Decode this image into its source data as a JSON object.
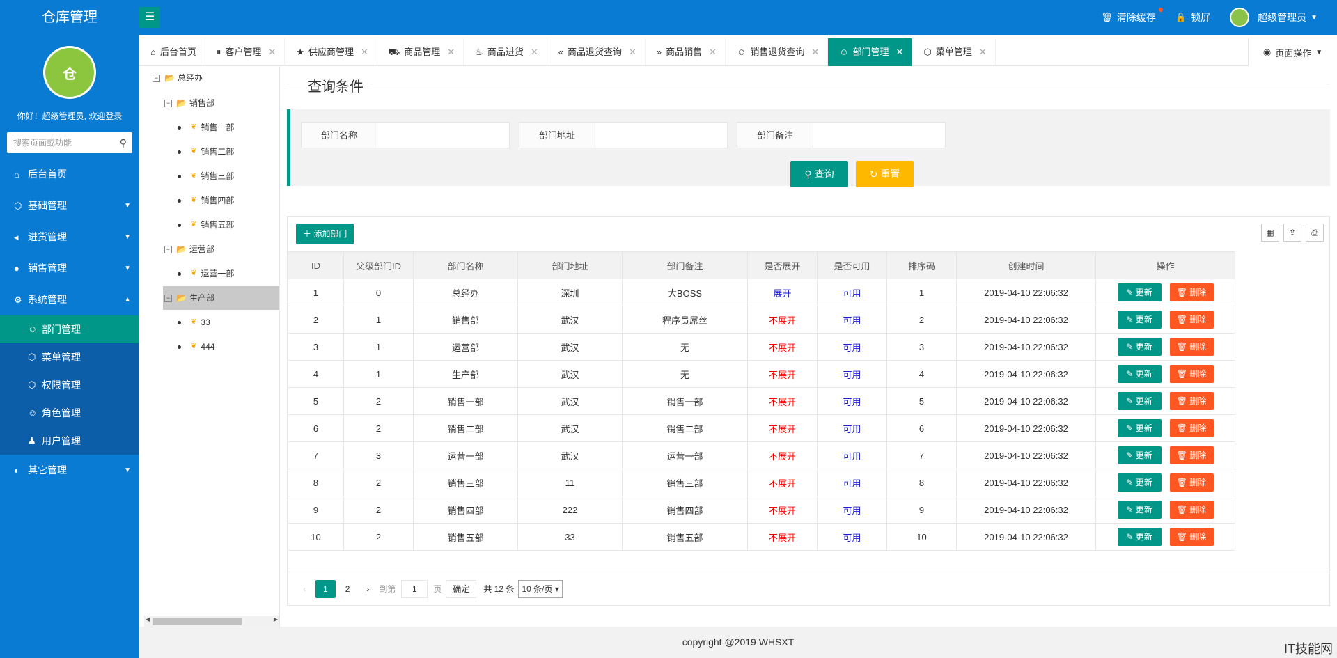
{
  "header": {
    "logo": "仓库管理",
    "clear_cache": "清除缓存",
    "lock": "锁屏",
    "user": "超级管理员"
  },
  "sidebar": {
    "welcome": "你好！超级管理员, 欢迎登录",
    "search_placeholder": "搜索页面或功能",
    "items": [
      {
        "label": "后台首页"
      },
      {
        "label": "基础管理"
      },
      {
        "label": "进货管理"
      },
      {
        "label": "销售管理"
      },
      {
        "label": "系统管理"
      }
    ],
    "sub_items": [
      {
        "label": "部门管理"
      },
      {
        "label": "菜单管理"
      },
      {
        "label": "权限管理"
      },
      {
        "label": "角色管理"
      },
      {
        "label": "用户管理"
      }
    ],
    "other": "其它管理"
  },
  "tabs": [
    {
      "label": "后台首页"
    },
    {
      "label": "客户管理"
    },
    {
      "label": "供应商管理"
    },
    {
      "label": "商品管理"
    },
    {
      "label": "商品进货"
    },
    {
      "label": "商品退货查询"
    },
    {
      "label": "商品销售"
    },
    {
      "label": "销售退货查询"
    },
    {
      "label": "部门管理"
    },
    {
      "label": "菜单管理"
    }
  ],
  "page_op": "页面操作",
  "tree": {
    "root": "总经办",
    "sales": "销售部",
    "sales_children": [
      "销售一部",
      "销售二部",
      "销售三部",
      "销售四部",
      "销售五部"
    ],
    "ops": "运营部",
    "ops_children": [
      "运营一部"
    ],
    "prod": "生产部",
    "prod_children": [
      "33",
      "444"
    ]
  },
  "query": {
    "title": "查询条件",
    "name_label": "部门名称",
    "addr_label": "部门地址",
    "remark_label": "部门备注",
    "search_btn": "查询",
    "reset_btn": "重置"
  },
  "table": {
    "add_btn": "添加部门",
    "headers": [
      "ID",
      "父级部门ID",
      "部门名称",
      "部门地址",
      "部门备注",
      "是否展开",
      "是否可用",
      "排序码",
      "创建时间",
      "操作"
    ],
    "update_label": "更新",
    "delete_label": "删除",
    "rows": [
      [
        "1",
        "0",
        "总经办",
        "深圳",
        "大BOSS",
        "展开",
        "可用",
        "1",
        "2019-04-10 22:06:32"
      ],
      [
        "2",
        "1",
        "销售部",
        "武汉",
        "程序员屌丝",
        "不展开",
        "可用",
        "2",
        "2019-04-10 22:06:32"
      ],
      [
        "3",
        "1",
        "运营部",
        "武汉",
        "无",
        "不展开",
        "可用",
        "3",
        "2019-04-10 22:06:32"
      ],
      [
        "4",
        "1",
        "生产部",
        "武汉",
        "无",
        "不展开",
        "可用",
        "4",
        "2019-04-10 22:06:32"
      ],
      [
        "5",
        "2",
        "销售一部",
        "武汉",
        "销售一部",
        "不展开",
        "可用",
        "5",
        "2019-04-10 22:06:32"
      ],
      [
        "6",
        "2",
        "销售二部",
        "武汉",
        "销售二部",
        "不展开",
        "可用",
        "6",
        "2019-04-10 22:06:32"
      ],
      [
        "7",
        "3",
        "运营一部",
        "武汉",
        "运营一部",
        "不展开",
        "可用",
        "7",
        "2019-04-10 22:06:32"
      ],
      [
        "8",
        "2",
        "销售三部",
        "11",
        "销售三部",
        "不展开",
        "可用",
        "8",
        "2019-04-10 22:06:32"
      ],
      [
        "9",
        "2",
        "销售四部",
        "222",
        "销售四部",
        "不展开",
        "可用",
        "9",
        "2019-04-10 22:06:32"
      ],
      [
        "10",
        "2",
        "销售五部",
        "33",
        "销售五部",
        "不展开",
        "可用",
        "10",
        "2019-04-10 22:06:32"
      ]
    ]
  },
  "pager": {
    "page1": "1",
    "page2": "2",
    "goto": "到第",
    "page_value": "1",
    "page_unit": "页",
    "confirm": "确定",
    "total": "共 12 条",
    "per_page": "10 条/页"
  },
  "footer": "copyright @2019 WHSXT",
  "watermark": "IT技能网"
}
